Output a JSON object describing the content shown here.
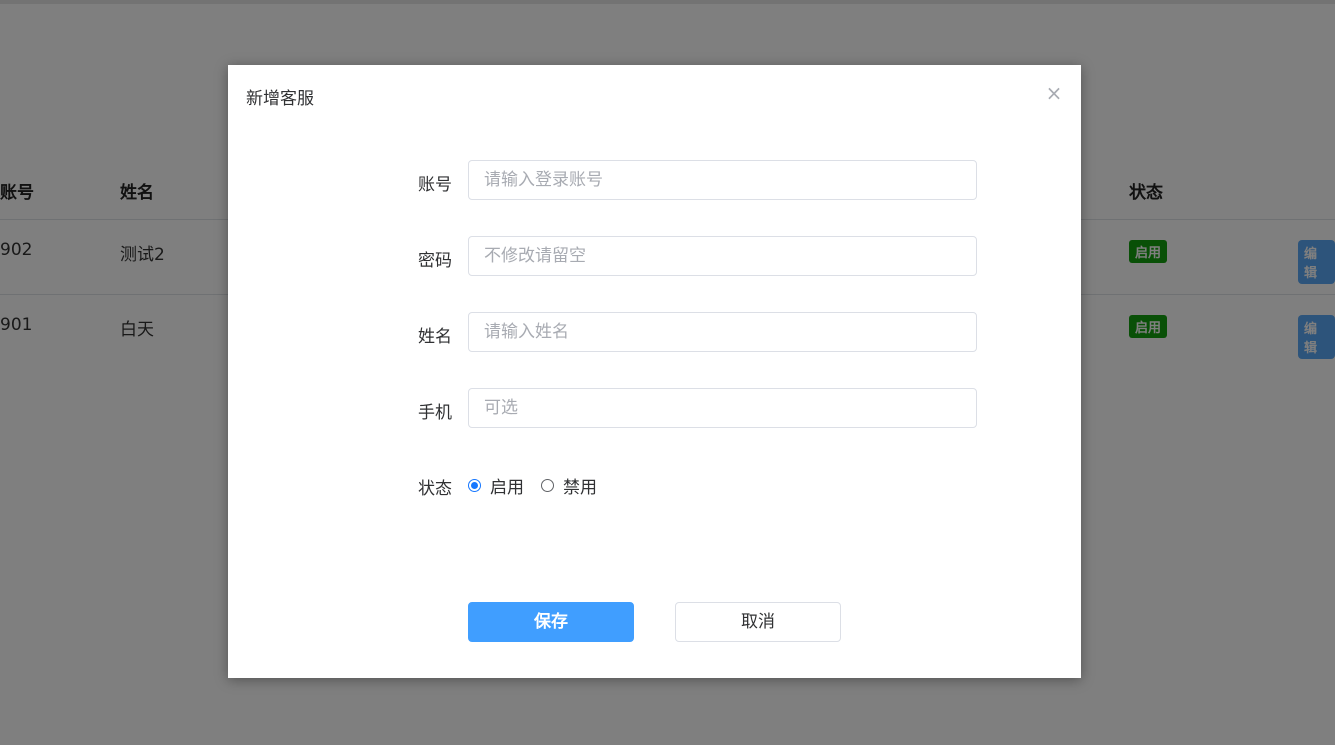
{
  "background": {
    "table": {
      "headers": {
        "account": "账号",
        "name": "姓名",
        "status": "状态"
      },
      "rows": [
        {
          "account": "902",
          "name": "测试2",
          "status": "启用",
          "action": "编辑"
        },
        {
          "account": "901",
          "name": "白天",
          "status": "启用",
          "action": "编辑"
        }
      ]
    }
  },
  "dialog": {
    "title": "新增客服",
    "close_icon": "×",
    "fields": {
      "account": {
        "label": "账号",
        "placeholder": "请输入登录账号",
        "value": ""
      },
      "password": {
        "label": "密码",
        "placeholder": "不修改请留空",
        "value": ""
      },
      "name": {
        "label": "姓名",
        "placeholder": "请输入姓名",
        "value": ""
      },
      "phone": {
        "label": "手机",
        "placeholder": "可选",
        "value": ""
      }
    },
    "status": {
      "label": "状态",
      "options": [
        {
          "label": "启用",
          "checked": true
        },
        {
          "label": "禁用",
          "checked": false
        }
      ]
    },
    "buttons": {
      "save": "保存",
      "cancel": "取消"
    }
  },
  "colors": {
    "primary": "#409eff",
    "tag_green": "#13a10e",
    "radio_checked": "#1677ff"
  }
}
